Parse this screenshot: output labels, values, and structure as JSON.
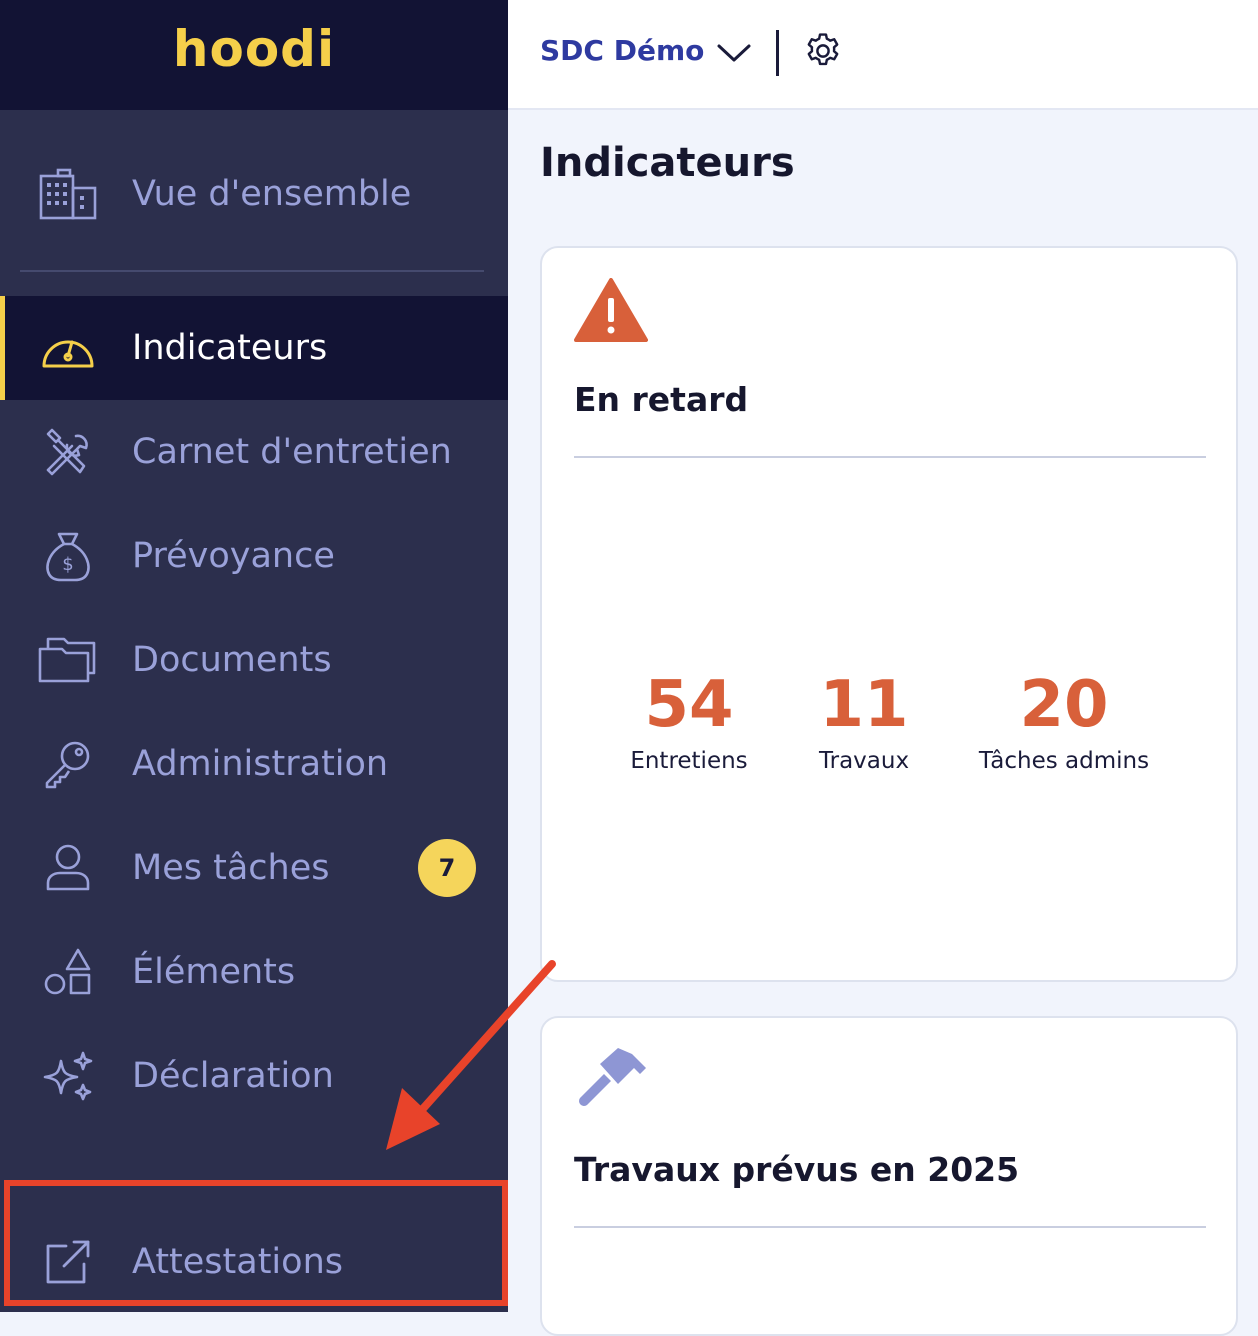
{
  "app": {
    "logo": "hoodi"
  },
  "topbar": {
    "org_name": "SDC Démo"
  },
  "sidebar": {
    "items": [
      {
        "label": "Vue d'ensemble",
        "icon": "building-icon"
      },
      {
        "label": "Indicateurs",
        "icon": "gauge-icon",
        "active": true
      },
      {
        "label": "Carnet d'entretien",
        "icon": "tools-icon"
      },
      {
        "label": "Prévoyance",
        "icon": "money-bag-icon"
      },
      {
        "label": "Documents",
        "icon": "folder-icon"
      },
      {
        "label": "Administration",
        "icon": "key-icon"
      },
      {
        "label": "Mes tâches",
        "icon": "user-icon",
        "badge": "7"
      },
      {
        "label": "Éléments",
        "icon": "shapes-icon"
      },
      {
        "label": "Déclaration",
        "icon": "sparkles-icon"
      },
      {
        "label": "Attestations",
        "icon": "external-link-icon"
      }
    ]
  },
  "main": {
    "title": "Indicateurs",
    "cards": [
      {
        "title": "En retard",
        "icon": "warning-icon",
        "stats": [
          {
            "value": "54",
            "label": "Entretiens"
          },
          {
            "value": "11",
            "label": "Travaux"
          },
          {
            "value": "20",
            "label": "Tâches admins"
          }
        ]
      },
      {
        "title": "Travaux prévus en 2025",
        "icon": "hammer-icon"
      }
    ]
  },
  "colors": {
    "accent": "#f5cf4a",
    "sidebar": "#2c2f4d",
    "alert": "#d8603a",
    "annotation": "#e8432a"
  }
}
